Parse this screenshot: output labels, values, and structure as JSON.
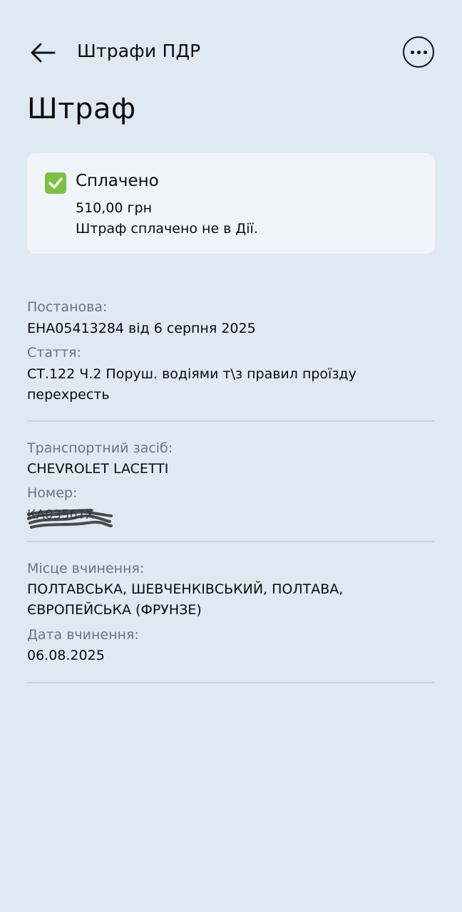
{
  "header": {
    "title": "Штрафи ПДР",
    "back_icon": "arrow-left-icon",
    "more_icon": "more-horizontal-icon"
  },
  "page": {
    "title": "Штраф"
  },
  "status": {
    "icon": "check-square-icon",
    "label": "Сплачено",
    "amount": "510,00 грн",
    "note": "Штраф сплачено не в Дії.",
    "accent_color": "#7bc142"
  },
  "details": {
    "resolution_label": "Постанова:",
    "resolution_value": "ЕНА05413284 від 6 серпня 2025",
    "article_label": "Стаття:",
    "article_value": "СТ.122 Ч.2 Поруш. водіями т\\з правил проїзду перехресть",
    "vehicle_label": "Транспортний засіб:",
    "vehicle_value": "CHEVROLET LACETTI",
    "plate_label": "Номер:",
    "plate_value": "КА0356ТХ",
    "place_label": "Місце вчинення:",
    "place_value": "ПОЛТАВСЬКА, ШЕВЧЕНКІВСЬКИЙ, ПОЛТАВА, ЄВРОПЕЙСЬКА (ФРУНЗЕ)",
    "date_label": "Дата вчинення:",
    "date_value": "06.08.2025"
  },
  "colors": {
    "background": "#dfe9f2",
    "card": "#f1f5f9",
    "label_text": "#6f7378",
    "divider": "#c9d5e0"
  }
}
